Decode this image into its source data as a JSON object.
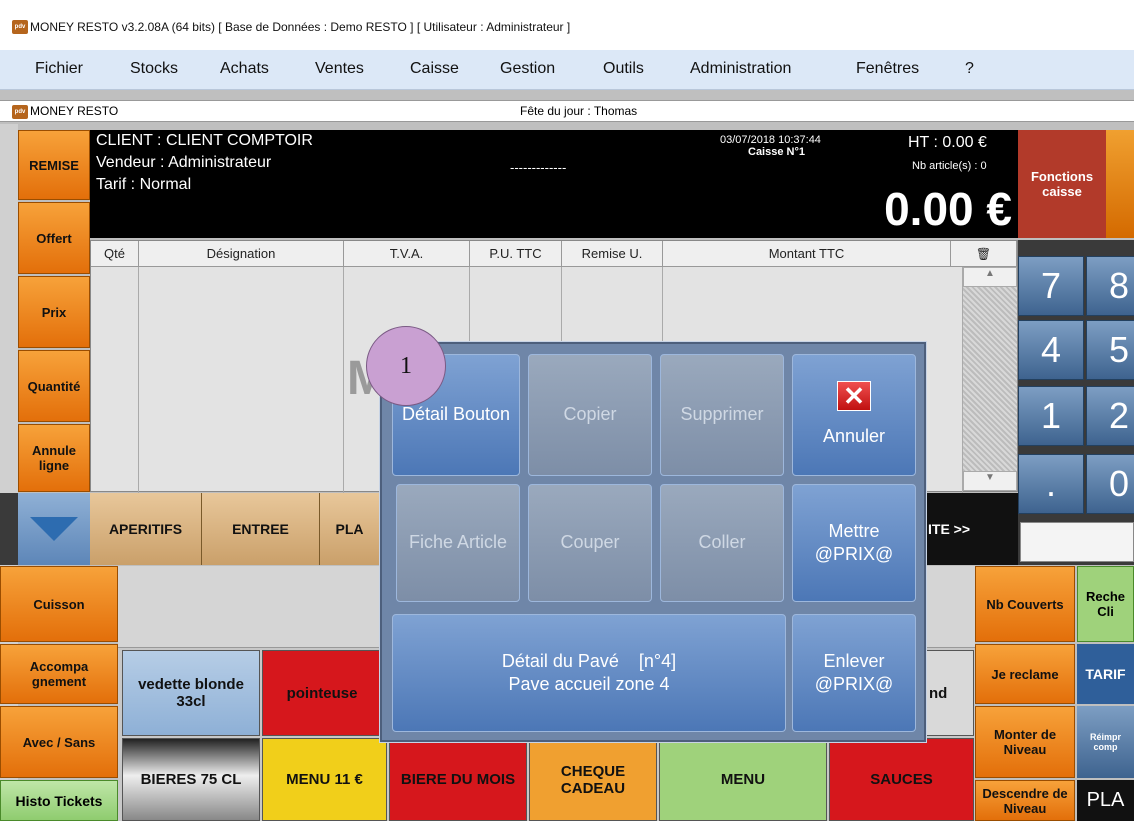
{
  "window": {
    "title": "MONEY RESTO v3.2.08A (64 bits) [ Base de Données : Demo RESTO ] [ Utilisateur : Administrateur ]",
    "logo_text": "pdv"
  },
  "menu": [
    "Fichier",
    "Stocks",
    "Achats",
    "Ventes",
    "Caisse",
    "Gestion",
    "Outils",
    "Administration",
    "Fenêtres",
    "?"
  ],
  "inner": {
    "title": "MONEY RESTO",
    "fete": "Fête du jour : Thomas"
  },
  "left_buttons": [
    "REMISE",
    "Offert",
    "Prix",
    "Quantité",
    "Annule ligne"
  ],
  "header": {
    "client": "CLIENT : CLIENT COMPTOIR",
    "vendeur": "Vendeur : Administrateur",
    "tarif": "Tarif : Normal",
    "dashes": "-------------",
    "datetime": "03/07/2018 10:37:44",
    "caisse": "Caisse N°1",
    "ht": "HT : 0.00 €",
    "nb_articles": "Nb article(s) : 0",
    "total": "0.00 €"
  },
  "fonctions_caisse": "Fonctions caisse",
  "grid_columns": [
    "Qté",
    "Désignation",
    "T.V.A.",
    "P.U. TTC",
    "Remise U.",
    "Montant TTC"
  ],
  "grid_bg_text": "M",
  "categories": [
    "APERITIFS",
    "ENTREE",
    "PLA"
  ],
  "suite": "ITE >>",
  "numpad": [
    "7",
    "8",
    "4",
    "5",
    "1",
    "2",
    ".",
    "0"
  ],
  "left_bottom": [
    "Cuisson",
    "Accompa gnement",
    "Avec / Sans",
    "Histo Tickets"
  ],
  "products": {
    "vedette": "vedette blonde 33cl",
    "pointeuse": "pointeuse",
    "nd": "nd",
    "bieres75": "BIERES 75 CL",
    "menu11": "MENU 11 €",
    "biere_mois": "BIERE DU MOIS",
    "cheque": "CHEQUE CADEAU",
    "menu": "MENU",
    "sauces": "SAUCES"
  },
  "right_buttons": [
    "Nb Couverts",
    "Je reclame",
    "Monter de Niveau",
    "Descendre de Niveau"
  ],
  "right_far": [
    "Reche Cli",
    "TARIF",
    "Réimpr comp",
    "PLA"
  ],
  "dialog": {
    "badge": "1",
    "detail_bouton": "Détail Bouton",
    "copier": "Copier",
    "supprimer": "Supprimer",
    "annuler": "Annuler",
    "fiche_article": "Fiche Article",
    "couper": "Couper",
    "coller": "Coller",
    "mettre_prix": "Mettre @PRIX@",
    "detail_pave_line1": "Détail du Pavé    [n°4]",
    "detail_pave_line2": "Pave accueil zone 4",
    "enlever_prix": "Enlever @PRIX@"
  },
  "colors": {
    "orange": "#e36f0a",
    "blue_dialog": "#4c77b6",
    "red": "#d6171c",
    "green": "#9fd27b"
  }
}
